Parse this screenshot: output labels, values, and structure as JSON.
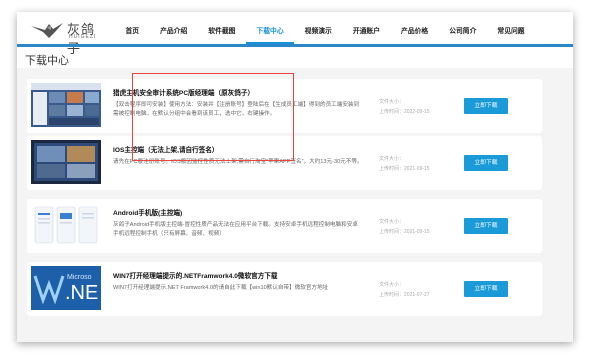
{
  "logo": {
    "name": "灰鸽子",
    "subtitle": "HUIGEZI"
  },
  "nav": [
    {
      "label": "首页"
    },
    {
      "label": "产品介绍"
    },
    {
      "label": "软件截图"
    },
    {
      "label": "下载中心",
      "active": true
    },
    {
      "label": "视频演示"
    },
    {
      "label": "开通账户"
    },
    {
      "label": "产品价格"
    },
    {
      "label": "公司简介"
    },
    {
      "label": "常见问题"
    }
  ],
  "page": {
    "title": "下载中心"
  },
  "downloads": [
    {
      "title": "猎虎主机安全审计系统PC版经理端（原灰鸽子）",
      "desc": "【双击程序即可安装】使用方法：安装并【注册账号】登陆后在【生成员工端】得到的员工端安装到需被控制电脑，在默认分组中会看到该员工，选中它，右键操作。",
      "size_label": "文件大小：",
      "date_label": "上传时间：",
      "date": "2022-09-15",
      "button": "立即下载"
    },
    {
      "title": "IOS主控端（无法上架,请自行签名）",
      "desc": "请先在PC版注册账号。IOS版因监控性质无法上架,需自行淘宝“苹果APP签名”，大约13元-30元不等。",
      "size_label": "文件大小：",
      "date_label": "上传时间：",
      "date": "2021-09-15",
      "button": "立即下载"
    },
    {
      "title": "Android手机版(主控端)",
      "desc": "灰鸽子Android手机版主控端-冒控性质产品无法在应用平台下载。支持安卓手机远程控制电脑和安卓手机远程控制手机（只有屏幕、音频、视频）",
      "size_label": "文件大小：",
      "date_label": "上传时间：",
      "date": "2021-09-15",
      "button": "立即下载"
    },
    {
      "title": "WIN7打开经理端提示的.NETFramwork4.0微软官方下载",
      "desc": "WIN7打开经理端提示.NET Framwork4.0的请自此下载【win10默认自带】微软官方地址",
      "size_label": "文件大小：",
      "date_label": "上传时间：",
      "date": "2021-07-27",
      "button": "立即下载"
    }
  ],
  "thumb4": {
    "line1": "Microso",
    "line2": ".NE"
  },
  "colors": {
    "accent": "#1a9bd8",
    "highlight": "#e8453c",
    "bar": "#2a88c8"
  }
}
